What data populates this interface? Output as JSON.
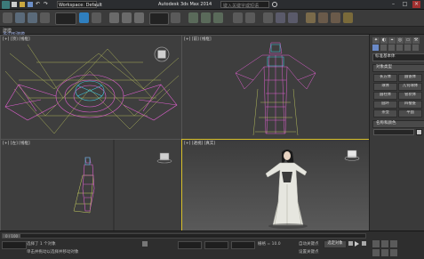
{
  "titlebar": {
    "workspace": "Workspace: Default",
    "app_title": "Autodesk 3ds Max 2014",
    "search_placeholder": "键入关键字或短语"
  },
  "ribbon": {
    "label1": "建模",
    "label2": "多边形建模"
  },
  "viewports": {
    "top": "[+] [顶] [线框]",
    "front": "[+] [前] [线框]",
    "left": "[+] [左] [线框]",
    "persp": "[+] [透视] [真实]"
  },
  "command_panel": {
    "dropdown": "标准基本体",
    "rollout_object_type": "对象类型",
    "rollout_name_color": "名称和颜色",
    "buttons": [
      "长方体",
      "圆锥体",
      "球体",
      "几何球体",
      "圆柱体",
      "管状体",
      "圆环",
      "四棱锥",
      "茶壶",
      "平面"
    ]
  },
  "statusbar": {
    "frame": "0 / 100",
    "line1": "选择了 1 个对象",
    "line2": "单击并拖动以选择并移动对象",
    "auto_key": "自动关键点",
    "set_key": "设置关键点",
    "selected": "选定对象",
    "grid": "栅格 = 10.0"
  },
  "colors": {
    "accent": "#d8c02a",
    "wire_pink": "#e060d0",
    "wire_yellow": "#c8d060",
    "wire_cyan": "#40c8e0"
  }
}
